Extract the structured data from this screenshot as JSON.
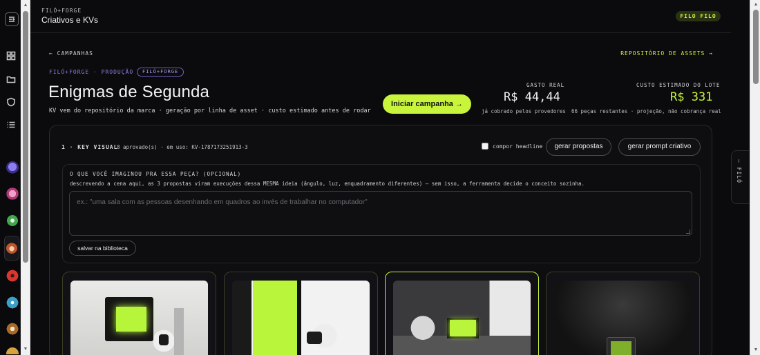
{
  "topbar": {
    "brand": "FILÓ+FORGE",
    "title": "Criativos e KVs",
    "user_pill": "FILO FILO"
  },
  "nav": {
    "back": "← CAMPANHAS",
    "repo": "REPOSITÓRIO DE ASSETS →"
  },
  "header": {
    "crumb": "FILÓ+FORGE · PRODUÇÃO",
    "crumb_tag": "FILÓ+FORGE",
    "title": "Enigmas de Segunda",
    "subtitle": "KV vem do repositório da marca · geração por linha de asset · custo estimado antes de rodar",
    "cta": "Iniciar campanha →"
  },
  "stats": {
    "spent": {
      "label": "GASTO REAL",
      "value": "R$ 44,44",
      "note": "já cobrado pelos provedores"
    },
    "estimate": {
      "label": "CUSTO ESTIMADO DO LOTE",
      "value": "R$ 331",
      "note": "66 peças restantes · projeção, não cobrança real"
    }
  },
  "kv": {
    "heading": "1 · KEY VISUAL",
    "meta": "8 aprovado(s) · em uso: KV-1787173251913-3",
    "compose_label": "compor headline",
    "btn_proposals": "gerar propostas",
    "btn_prompt": "gerar prompt criativo",
    "question_label": "O QUE VOCÊ IMAGINOU PRA ESSA PEÇA? (OPCIONAL)",
    "question_help": "descrevendo a cena aqui, as 3 propostas viram execuções dessa MESMA ideia (ângulo, luz, enquadramento diferentes) — sem isso, a ferramenta decide o conceito sozinha.",
    "placeholder": "ex.: \"uma sala com as pessoas desenhando em quadros ao invés de trabalhar no computador\"",
    "save_label": "salvar na biblioteca"
  },
  "drawer": {
    "label": "— FILÓ"
  },
  "colors": {
    "accent": "#c8f53c",
    "purple": "#8b7fe8",
    "bg": "#0b0b0d"
  },
  "icons": [
    "menu-toggle-icon",
    "grid-icon",
    "folder-icon",
    "shield-icon",
    "list-icon"
  ]
}
